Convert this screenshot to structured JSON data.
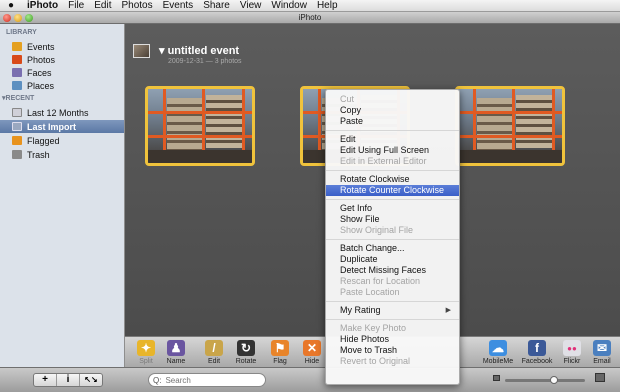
{
  "menubar": {
    "apple": "",
    "items": [
      "iPhoto",
      "File",
      "Edit",
      "Photos",
      "Events",
      "Share",
      "View",
      "Window",
      "Help"
    ]
  },
  "window": {
    "title": "iPhoto"
  },
  "sidebar": {
    "library_header": "LIBRARY",
    "library": [
      {
        "label": "Events",
        "icon": "events-icon",
        "color": "#e4a020"
      },
      {
        "label": "Photos",
        "icon": "photos-icon",
        "color": "#d84a1a"
      },
      {
        "label": "Faces",
        "icon": "faces-icon",
        "color": "#7a6fb0"
      },
      {
        "label": "Places",
        "icon": "places-icon",
        "color": "#5d8fc0"
      }
    ],
    "recent_header": "RECENT",
    "recent": [
      {
        "label": "Last 12 Months",
        "icon": "calendar-icon",
        "color": "#d0d0d8"
      },
      {
        "label": "Last Import",
        "icon": "import-icon",
        "color": "#9aa8c0",
        "selected": true
      },
      {
        "label": "Flagged",
        "icon": "flag-icon",
        "color": "#e8931e"
      },
      {
        "label": "Trash",
        "icon": "trash-icon",
        "color": "#8a8a8a"
      }
    ]
  },
  "event": {
    "title": "untitled event",
    "subtitle": "2009-12-31 — 3 photos"
  },
  "toolbar": {
    "buttons": [
      {
        "label": "Split",
        "icon": "split-icon",
        "color": "#e8b52a",
        "glyph": "✦",
        "dim": true
      },
      {
        "label": "Name",
        "icon": "name-icon",
        "color": "#6a55a0",
        "glyph": "♟"
      },
      {
        "label": "Edit",
        "icon": "edit-pencil-icon",
        "color": "#c9a54a",
        "glyph": "/"
      },
      {
        "label": "Rotate",
        "icon": "rotate-icon",
        "color": "#333333",
        "glyph": "↻"
      },
      {
        "label": "Flag",
        "icon": "flag-icon",
        "color": "#e8842a",
        "glyph": "⚑"
      },
      {
        "label": "Hide",
        "icon": "hide-icon",
        "color": "#e8772a",
        "glyph": "✕"
      }
    ],
    "share": [
      {
        "label": "MobileMe",
        "icon": "mobileme-icon",
        "color": "#3d8ee0",
        "glyph": "☁"
      },
      {
        "label": "Facebook",
        "icon": "facebook-icon",
        "color": "#3b5998",
        "glyph": "f"
      },
      {
        "label": "Flickr",
        "icon": "flickr-icon",
        "color": "#e0e0e6",
        "glyph": "●●"
      },
      {
        "label": "Email",
        "icon": "email-icon",
        "color": "#4a7fbf",
        "glyph": "✉"
      }
    ]
  },
  "bottombar": {
    "add": "+",
    "info": "i",
    "fullscreen": "↖↘",
    "search_placeholder": "Search",
    "search_icon": "Q:"
  },
  "zoom": {
    "value": 0.62
  },
  "context_menu": {
    "groups": [
      [
        {
          "label": "Cut",
          "disabled": true
        },
        {
          "label": "Copy"
        },
        {
          "label": "Paste"
        }
      ],
      [
        {
          "label": "Edit"
        },
        {
          "label": "Edit Using Full Screen"
        },
        {
          "label": "Edit in External Editor",
          "disabled": true
        }
      ],
      [
        {
          "label": "Rotate Clockwise"
        },
        {
          "label": "Rotate Counter Clockwise",
          "highlighted": true
        }
      ],
      [
        {
          "label": "Get Info"
        },
        {
          "label": "Show File"
        },
        {
          "label": "Show Original File",
          "disabled": true
        }
      ],
      [
        {
          "label": "Batch Change..."
        },
        {
          "label": "Duplicate"
        },
        {
          "label": "Detect Missing Faces"
        },
        {
          "label": "Rescan for Location",
          "disabled": true
        },
        {
          "label": "Paste Location",
          "disabled": true
        }
      ],
      [
        {
          "label": "My Rating",
          "submenu": true
        }
      ],
      [
        {
          "label": "Make Key Photo",
          "disabled": true
        },
        {
          "label": "Hide Photos"
        },
        {
          "label": "Move to Trash"
        },
        {
          "label": "Revert to Original",
          "disabled": true
        }
      ]
    ]
  }
}
